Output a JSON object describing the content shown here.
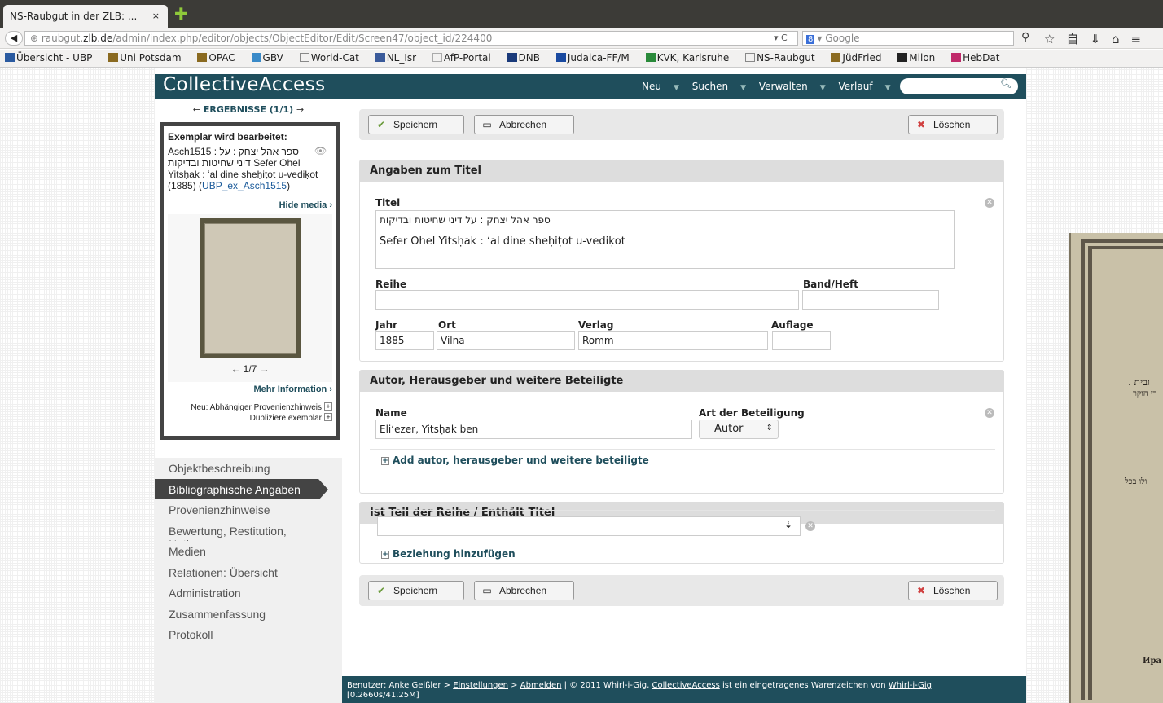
{
  "browser": {
    "tab_title": "NS-Raubgut in der ZLB: ...",
    "tab_close": "×",
    "new_tab": "✚",
    "url_prefix": "raubgut.",
    "url_host": "zlb.de",
    "url_path": "/admin/index.php/editor/objects/ObjectEditor/Edit/Screen47/object_id/224400",
    "url_controls": "▾ C",
    "search_engine": "8",
    "search_placeholder": "▾ Google",
    "toolbar_icons": "☆自⇓⌂≡",
    "bookmarks": [
      "Übersicht - UBP",
      "Uni Potsdam",
      "OPAC",
      "GBV",
      "World-Cat",
      "NL_Isr",
      "AfP-Portal",
      "DNB",
      "Judaica-FF/M",
      "KVK, Karlsruhe",
      "NS-Raubgut",
      "JüdFried",
      "Milon",
      "HebDat"
    ]
  },
  "app": {
    "logo": "CollectiveAccess",
    "nav": [
      "Neu",
      "Suchen",
      "Verwalten",
      "Verlauf"
    ]
  },
  "results": {
    "label": "ERGEBNISSE (1/1)",
    "prev": "←",
    "next": "→"
  },
  "inspector": {
    "title": "Exemplar wird bearbeitet:",
    "id_line": "Asch1515 : ספר אהל יצחק : על",
    "hebrew_line": "דיני שחיטות ובדיקות Sefer Ohel",
    "translit_line": "Yitsḥak : ʻal dine sheḥiṭot u-vediḳot",
    "year_prefix": "(1885) (",
    "link": "UBP_ex_Asch1515",
    "year_suffix": ")",
    "hide_media": "Hide media ›",
    "pager": "← 1/7 →",
    "more_info": "Mehr Information ›",
    "link_provenance": "Neu: Abhängiger Provenienzhinweis",
    "link_duplicate": "Dupliziere exemplar"
  },
  "sidenav": [
    "Objektbeschreibung",
    "Bibliographische Angaben",
    "Provenienzhinweise",
    "Bewertung, Restitution, Notizen",
    "Medien",
    "Relationen: Übersicht",
    "Administration",
    "Zusammenfassung",
    "Protokoll"
  ],
  "toolbar": {
    "save": "Speichern",
    "cancel": "Abbrechen",
    "delete": "Löschen"
  },
  "title_section": {
    "heading": "Angaben zum Titel",
    "titel_label": "Titel",
    "titel_line1": "ספר אהל יצחק : על דיני שחיטות ובדיקות",
    "titel_line2": "Sefer Ohel Yitsḥak : ʻal dine sheḥiṭot u-vediḳot",
    "reihe_label": "Reihe",
    "reihe_value": "",
    "band_label": "Band/Heft",
    "band_value": "",
    "jahr_label": "Jahr",
    "jahr_value": "1885",
    "ort_label": "Ort",
    "ort_value": "Vilna",
    "verlag_label": "Verlag",
    "verlag_value": "Romm",
    "auflage_label": "Auflage",
    "auflage_value": ""
  },
  "author_section": {
    "heading": "Autor, Herausgeber und weitere Beteiligte",
    "name_label": "Name",
    "name_value": "Eliʻezer, Yitsḥak ben",
    "role_label": "Art der Beteiligung",
    "role_value": "Autor",
    "add_link": "Add autor, herausgeber und weitere beteiligte"
  },
  "series_section": {
    "heading": "Ist Teil der Reihe / Enthält Titel",
    "value": "",
    "add_link": "Beziehung hinzufügen"
  },
  "footer": {
    "user": "Benutzer: Anke Geißler > ",
    "settings": "Einstellungen",
    "sep": " > ",
    "logout": "Abmelden",
    "copyright_pre": "   |   © 2011 Whirl-i-Gig, ",
    "ca": "CollectiveAccess",
    "copyright_mid": " ist ein eingetragenes Warenzeichen von ",
    "wig": "Whirl-i-Gig",
    "timing": "[0.2660s/41.25M]"
  },
  "scan": {
    "line1": ". ובית",
    "line2": "רי הוקר",
    "line3": "ולו בכל",
    "line4": "Ира"
  },
  "colors": {
    "header": "#1f4e5c",
    "nav_active": "#444444",
    "section_header": "#dddddd"
  }
}
